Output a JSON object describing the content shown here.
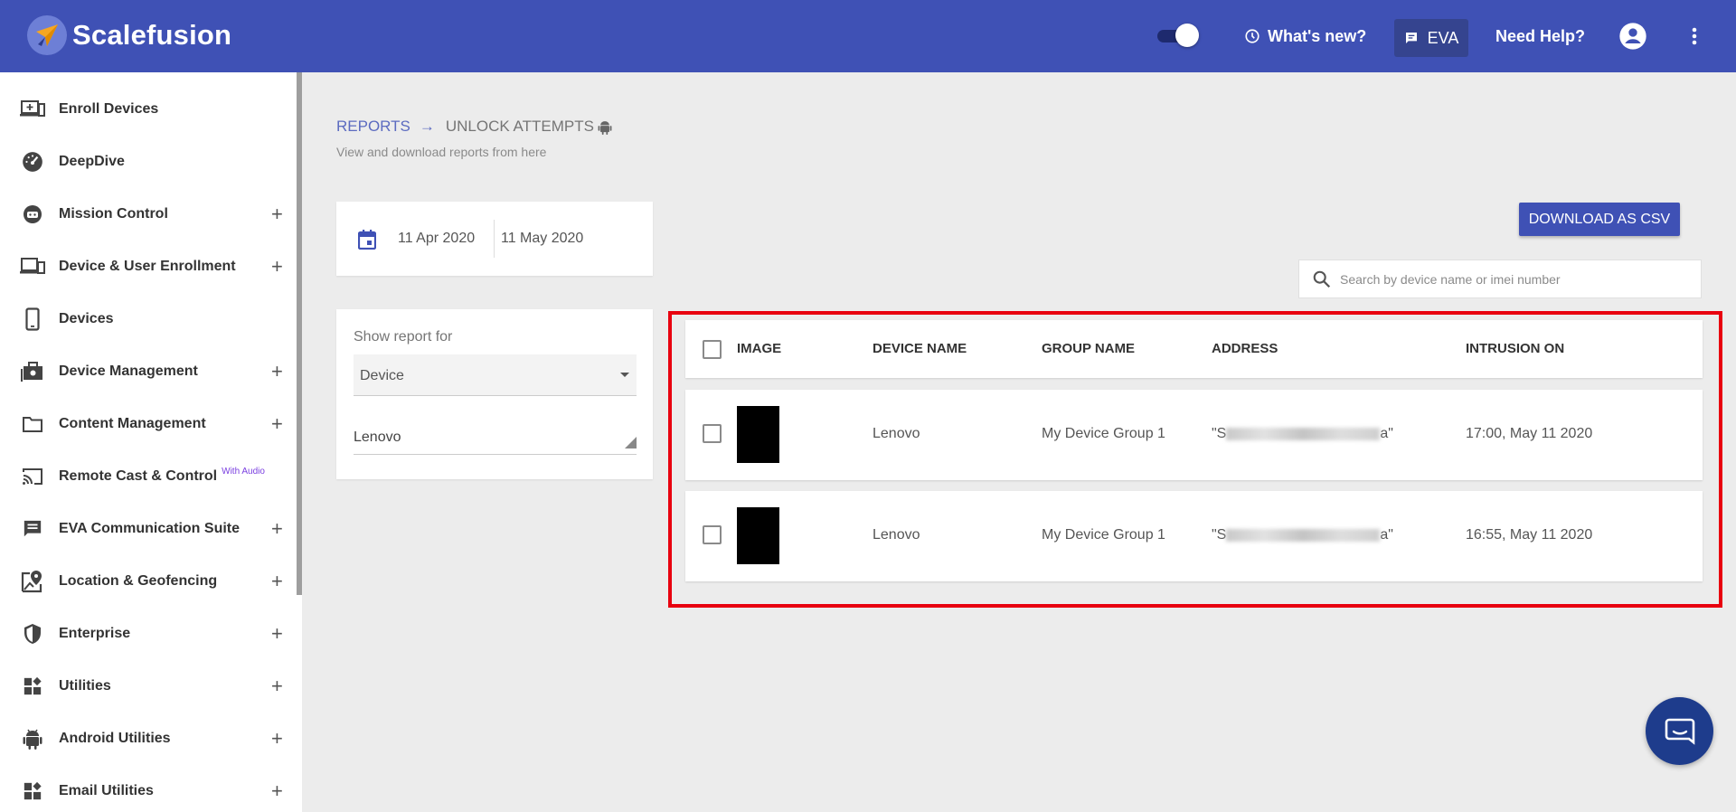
{
  "app": {
    "name": "Scalefusion"
  },
  "header": {
    "whats_new": "What's new?",
    "eva": "EVA",
    "need_help": "Need Help?",
    "toggle_state": "on"
  },
  "sidebar": {
    "items": [
      {
        "label": "Enroll Devices",
        "icon": "enroll-devices-icon",
        "expandable": false
      },
      {
        "label": "DeepDive",
        "icon": "speedometer-icon",
        "expandable": false
      },
      {
        "label": "Mission Control",
        "icon": "robot-icon",
        "expandable": true
      },
      {
        "label": "Device & User Enrollment",
        "icon": "devices-icon",
        "expandable": true
      },
      {
        "label": "Devices",
        "icon": "phone-icon",
        "expandable": false
      },
      {
        "label": "Device Management",
        "icon": "briefcase-icon",
        "expandable": true
      },
      {
        "label": "Content Management",
        "icon": "folder-icon",
        "expandable": true
      },
      {
        "label": "Remote Cast & Control",
        "badge": "With Audio",
        "icon": "cast-icon",
        "expandable": false
      },
      {
        "label": "EVA Communication Suite",
        "icon": "chat-icon",
        "expandable": true
      },
      {
        "label": "Location & Geofencing",
        "icon": "map-pin-icon",
        "expandable": true
      },
      {
        "label": "Enterprise",
        "icon": "shield-icon",
        "expandable": true
      },
      {
        "label": "Utilities",
        "icon": "widgets-icon",
        "expandable": true
      },
      {
        "label": "Android Utilities",
        "icon": "android-icon",
        "expandable": true
      },
      {
        "label": "Email Utilities",
        "icon": "widgets-icon",
        "expandable": true
      }
    ],
    "plus": "+"
  },
  "breadcrumb": {
    "root": "REPORTS",
    "arrow": "→",
    "current": "UNLOCK ATTEMPTS"
  },
  "subtitle": "View and download reports from here",
  "date_range": {
    "from": "11 Apr 2020",
    "to": "11 May 2020"
  },
  "filter": {
    "label": "Show report for",
    "selected": "Device",
    "device_value": "Lenovo"
  },
  "actions": {
    "download": "DOWNLOAD AS CSV"
  },
  "search": {
    "placeholder": "Search by device name or imei number"
  },
  "table": {
    "columns": [
      "IMAGE",
      "DEVICE NAME",
      "GROUP NAME",
      "ADDRESS",
      "INTRUSION ON"
    ],
    "rows": [
      {
        "device": "Lenovo",
        "group": "My Device Group 1",
        "address_start": "\"S",
        "address_end": "a\"",
        "intrusion": "17:00, May 11 2020"
      },
      {
        "device": "Lenovo",
        "group": "My Device Group 1",
        "address_start": "\"S",
        "address_end": "a\"",
        "intrusion": "16:55, May 11 2020"
      }
    ]
  },
  "colors": {
    "primary": "#3f51b5",
    "highlight": "#e8000f",
    "badge": "#7a3fe0"
  }
}
